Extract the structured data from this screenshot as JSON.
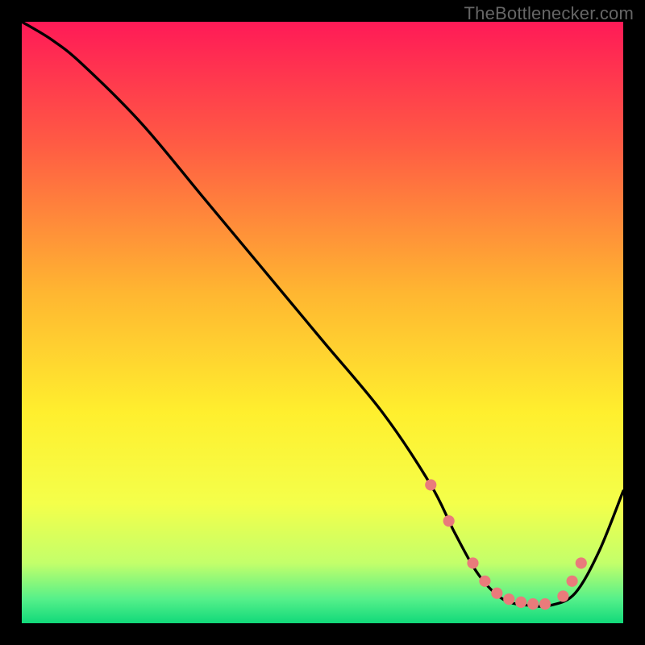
{
  "watermark": "TheBottlenecker.com",
  "chart_data": {
    "type": "line",
    "title": "",
    "xlabel": "",
    "ylabel": "",
    "xlim": [
      0,
      100
    ],
    "ylim": [
      0,
      100
    ],
    "series": [
      {
        "name": "curve",
        "x": [
          0,
          5,
          10,
          20,
          30,
          40,
          50,
          60,
          68,
          72,
          76,
          80,
          84,
          88,
          92,
          96,
          100
        ],
        "y": [
          100,
          97,
          93,
          83,
          71,
          59,
          47,
          35,
          23,
          15,
          8,
          4,
          3,
          3,
          5,
          12,
          22
        ]
      }
    ],
    "markers": {
      "name": "highlight-dots",
      "color": "#e97b7b",
      "radius": 6,
      "x": [
        68,
        71,
        75,
        77,
        79,
        81,
        83,
        85,
        87,
        90,
        91.5,
        93
      ],
      "y": [
        23,
        17,
        10,
        7,
        5,
        4,
        3.5,
        3.2,
        3.2,
        4.5,
        7,
        10
      ]
    },
    "background_gradient": {
      "type": "vertical",
      "stops": [
        {
          "pos": 0.0,
          "color": "#ff1a57"
        },
        {
          "pos": 0.2,
          "color": "#ff5a44"
        },
        {
          "pos": 0.45,
          "color": "#ffb631"
        },
        {
          "pos": 0.65,
          "color": "#ffef2e"
        },
        {
          "pos": 0.8,
          "color": "#f4ff4a"
        },
        {
          "pos": 0.9,
          "color": "#c3ff6a"
        },
        {
          "pos": 0.96,
          "color": "#55f08a"
        },
        {
          "pos": 1.0,
          "color": "#11d97a"
        }
      ]
    }
  }
}
